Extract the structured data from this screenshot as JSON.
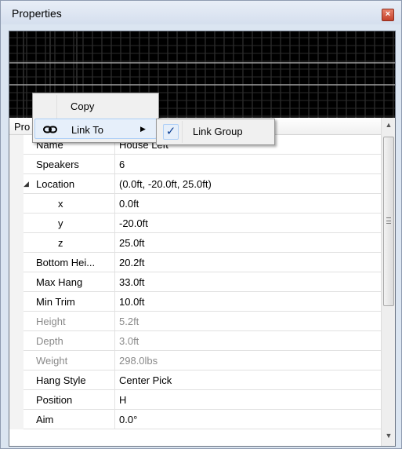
{
  "window": {
    "title": "Properties",
    "close_glyph": "×"
  },
  "grid": {
    "header": "Pro",
    "rows": [
      {
        "name": "Name",
        "value": "House Left",
        "indent": 1,
        "disabled": false
      },
      {
        "name": "Speakers",
        "value": "6",
        "indent": 1,
        "disabled": false
      },
      {
        "name": "Location",
        "value": "(0.0ft, -20.0ft, 25.0ft)",
        "indent": 1,
        "disabled": false,
        "expandable": true
      },
      {
        "name": "x",
        "value": "0.0ft",
        "indent": 2,
        "disabled": false
      },
      {
        "name": "y",
        "value": "-20.0ft",
        "indent": 2,
        "disabled": false
      },
      {
        "name": "z",
        "value": "25.0ft",
        "indent": 2,
        "disabled": false
      },
      {
        "name": "Bottom Hei...",
        "value": "20.2ft",
        "indent": 1,
        "disabled": false
      },
      {
        "name": "Max Hang",
        "value": "33.0ft",
        "indent": 1,
        "disabled": false
      },
      {
        "name": "Min Trim",
        "value": "10.0ft",
        "indent": 1,
        "disabled": false
      },
      {
        "name": "Height",
        "value": "5.2ft",
        "indent": 1,
        "disabled": true
      },
      {
        "name": "Depth",
        "value": "3.0ft",
        "indent": 1,
        "disabled": true
      },
      {
        "name": "Weight",
        "value": "298.0lbs",
        "indent": 1,
        "disabled": true
      },
      {
        "name": "Hang Style",
        "value": "Center Pick",
        "indent": 1,
        "disabled": false
      },
      {
        "name": "Position",
        "value": "H",
        "indent": 1,
        "disabled": false
      },
      {
        "name": "Aim",
        "value": "0.0°",
        "indent": 1,
        "disabled": false
      }
    ]
  },
  "context_menu": {
    "items": [
      {
        "label": "Copy"
      },
      {
        "label": "Link To",
        "has_submenu": true,
        "icon": "chain-link-icon"
      }
    ]
  },
  "submenu": {
    "items": [
      {
        "label": "Link Group",
        "checked": true,
        "check_glyph": "✓"
      }
    ]
  },
  "colors": {
    "accent": "#0b3d91",
    "disabled_text": "#8a8a8a",
    "preview_bg": "#000000"
  }
}
